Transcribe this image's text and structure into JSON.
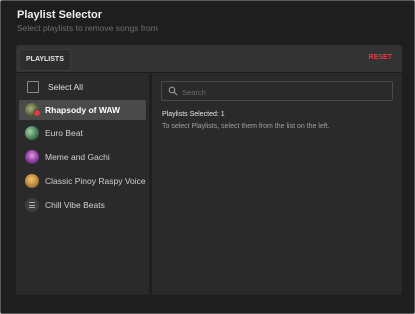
{
  "header": {
    "title": "Playlist Selector",
    "subtitle": "Select playlists to remove songs from"
  },
  "panel": {
    "tab_label": "PLAYLISTS",
    "reset_label": "RESET",
    "accent_color": "#e5393d"
  },
  "list": {
    "select_all_label": "Select All",
    "select_all_checked": false,
    "items": [
      {
        "label": "Rhapsody of WAW",
        "selected": true,
        "icon": "playlist-thumbnail"
      },
      {
        "label": "Euro Beat",
        "selected": false,
        "icon": "playlist-thumbnail"
      },
      {
        "label": "Meme and Gachi",
        "selected": false,
        "icon": "playlist-thumbnail"
      },
      {
        "label": "Classic Pinoy Raspy Voice",
        "selected": false,
        "icon": "playlist-thumbnail"
      },
      {
        "label": "Chill Vibe Beats",
        "selected": false,
        "icon": "list-icon"
      }
    ]
  },
  "detail": {
    "search_placeholder": "Search",
    "selected_count_text": "Playlists Selected: 1",
    "help_text": "To select Playlists, select them from the list on the left."
  }
}
